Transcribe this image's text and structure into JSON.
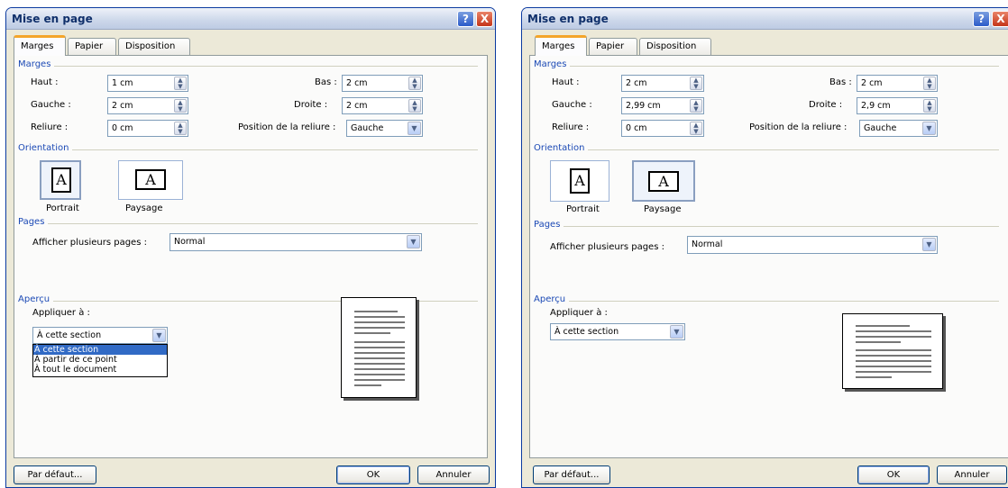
{
  "left": {
    "title": "Mise en page",
    "tabs": [
      "Marges",
      "Papier",
      "Disposition"
    ],
    "margins_section": "Marges",
    "haut_label": "Haut :",
    "haut_value": "1 cm",
    "gauche_label": "Gauche :",
    "gauche_value": "2 cm",
    "reliure_label": "Reliure :",
    "reliure_value": "0 cm",
    "bas_label": "Bas :",
    "bas_value": "2 cm",
    "droite_label": "Droite :",
    "droite_value": "2 cm",
    "position_label": "Position de la reliure :",
    "position_value": "Gauche",
    "orientation_section": "Orientation",
    "portrait_label": "Portrait",
    "paysage_label": "Paysage",
    "selected_orientation": "portrait",
    "pages_section": "Pages",
    "multi_label": "Afficher plusieurs pages :",
    "multi_value": "Normal",
    "apercu_section": "Aperçu",
    "apply_label": "Appliquer à :",
    "apply_value": "À cette section",
    "apply_options": [
      "À cette section",
      "À partir de ce point",
      "À tout le document"
    ],
    "default_button": "Par défaut...",
    "ok_button": "OK",
    "cancel_button": "Annuler",
    "help_glyph": "?",
    "close_glyph": "X",
    "page_glyph": "A"
  },
  "right": {
    "title": "Mise en page",
    "tabs": [
      "Marges",
      "Papier",
      "Disposition"
    ],
    "margins_section": "Marges",
    "haut_label": "Haut :",
    "haut_value": "2 cm",
    "gauche_label": "Gauche :",
    "gauche_value": "2,99 cm",
    "reliure_label": "Reliure :",
    "reliure_value": "0 cm",
    "bas_label": "Bas :",
    "bas_value": "2 cm",
    "droite_label": "Droite :",
    "droite_value": "2,9 cm",
    "position_label": "Position de la reliure :",
    "position_value": "Gauche",
    "orientation_section": "Orientation",
    "portrait_label": "Portrait",
    "paysage_label": "Paysage",
    "selected_orientation": "paysage",
    "pages_section": "Pages",
    "multi_label": "Afficher plusieurs pages :",
    "multi_value": "Normal",
    "apercu_section": "Aperçu",
    "apply_label": "Appliquer à :",
    "apply_value": "À cette section",
    "default_button": "Par défaut...",
    "ok_button": "OK",
    "cancel_button": "Annuler",
    "help_glyph": "?",
    "close_glyph": "X",
    "page_glyph": "A"
  }
}
